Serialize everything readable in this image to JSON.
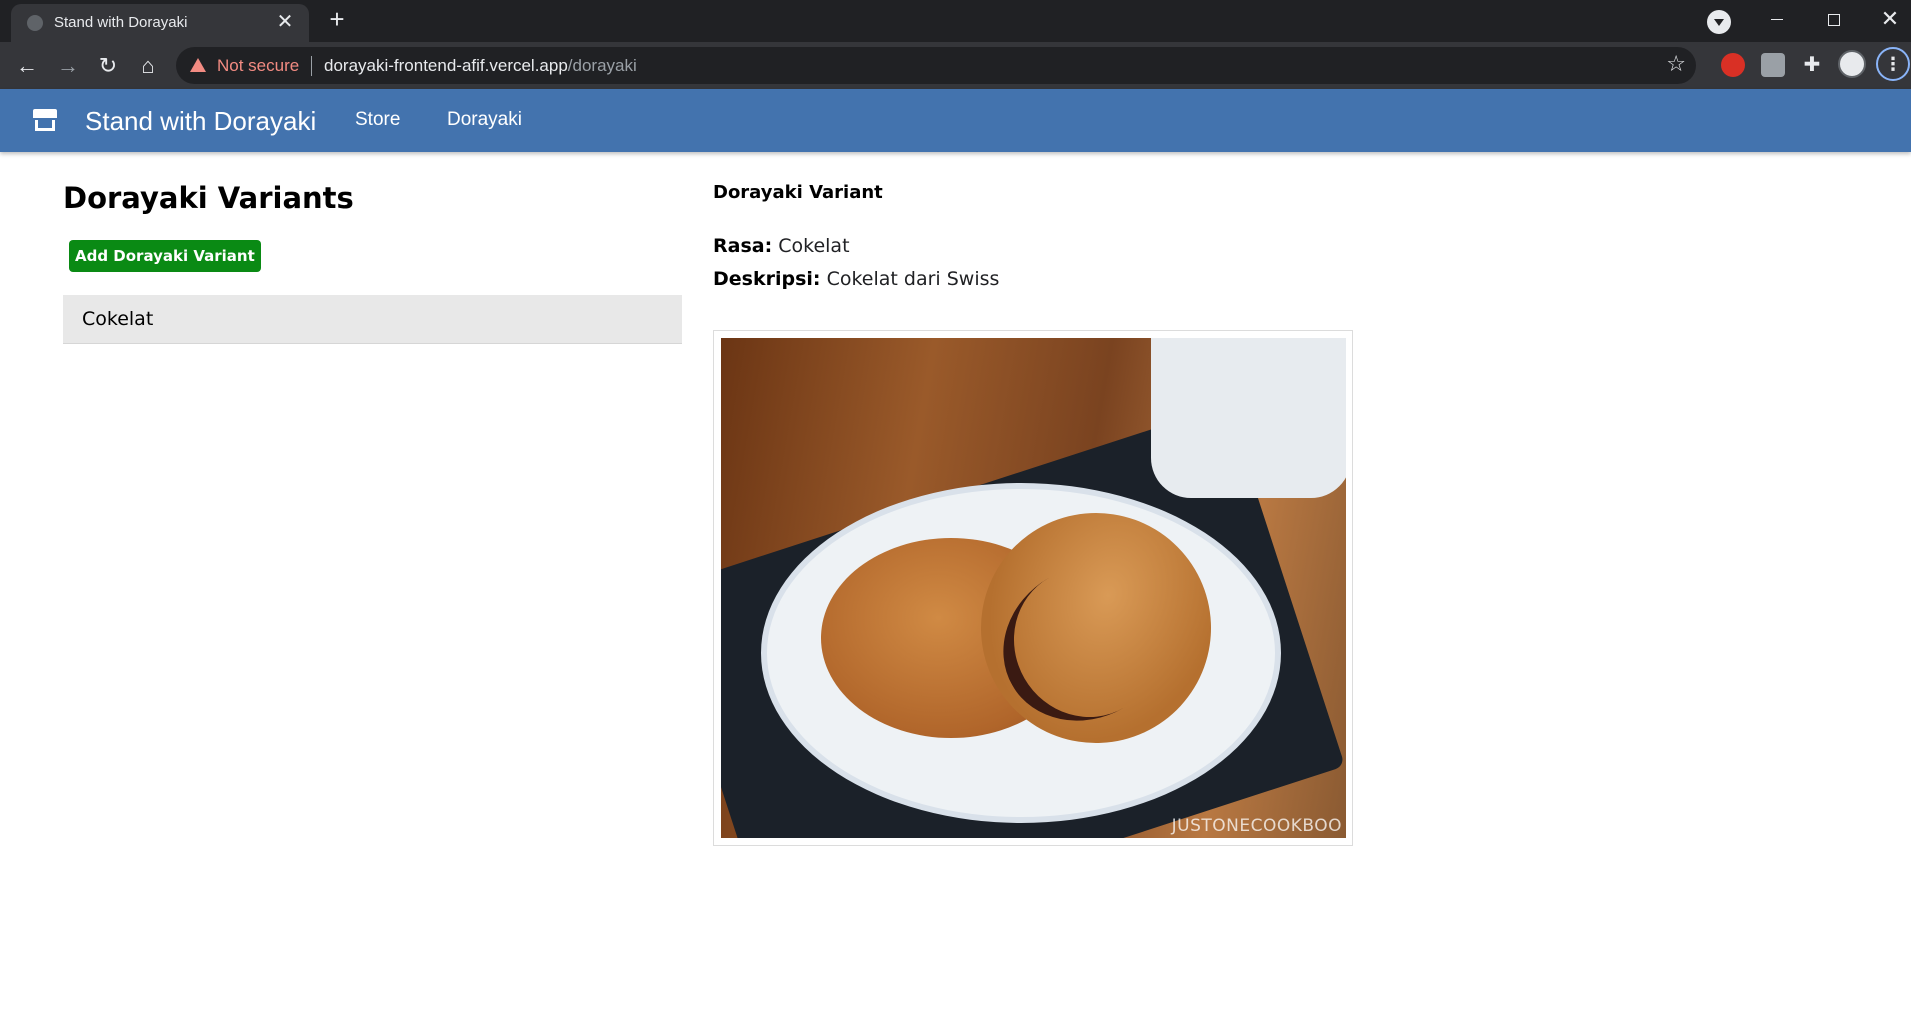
{
  "browser": {
    "tab_title": "Stand with Dorayaki",
    "tab_close": "✕",
    "new_tab": "+",
    "security_label": "Not secure",
    "url_host": "dorayaki-frontend-afif.vercel.app",
    "url_path": "/dorayaki",
    "icons": [
      "back-icon",
      "forward-icon",
      "reload-icon",
      "home-icon",
      "star-icon",
      "extension-icon",
      "profile-icon",
      "menu-icon"
    ]
  },
  "appbar": {
    "brand": "Stand with Dorayaki",
    "links": [
      "Store",
      "Dorayaki"
    ],
    "color": "#4373ae"
  },
  "list_panel": {
    "title": "Dorayaki Variants",
    "add_button": "Add Dorayaki Variant",
    "add_button_color": "#0a8a14",
    "items": [
      "Cokelat"
    ]
  },
  "detail_panel": {
    "heading": "Dorayaki Variant",
    "rasa_label": "Rasa:",
    "rasa_value": "Cokelat",
    "deskripsi_label": "Deskripsi:",
    "deskripsi_value": "Cokelat dari Swiss",
    "image_watermark": "JUSTONECOOKBOO"
  }
}
